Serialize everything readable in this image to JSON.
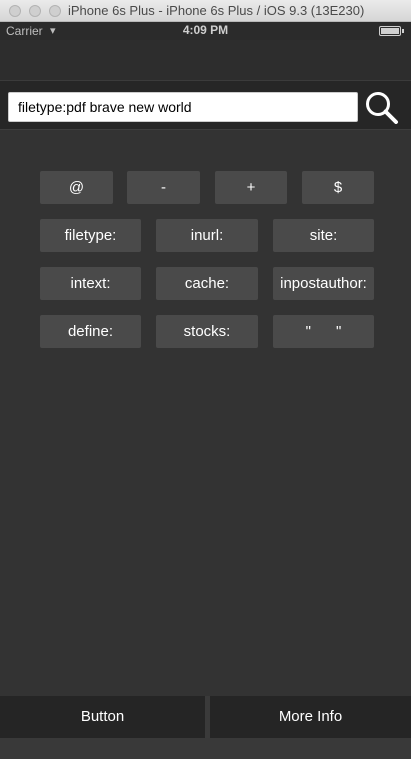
{
  "window": {
    "title": "iPhone 6s Plus - iPhone 6s Plus / iOS 9.3 (13E230)"
  },
  "statusbar": {
    "carrier": "Carrier",
    "time": "4:09 PM"
  },
  "search": {
    "value": "filetype:pdf brave new world"
  },
  "operators": {
    "row1": [
      "@",
      "-",
      "+",
      "$"
    ],
    "row2": [
      "filetype:",
      "inurl:",
      "site:"
    ],
    "row3": [
      "intext:",
      "cache:",
      "inpostauthor:"
    ],
    "row4": [
      "define:",
      "stocks:",
      "\"      \""
    ]
  },
  "bottom": {
    "left_label": "Button",
    "right_label": "More Info"
  }
}
